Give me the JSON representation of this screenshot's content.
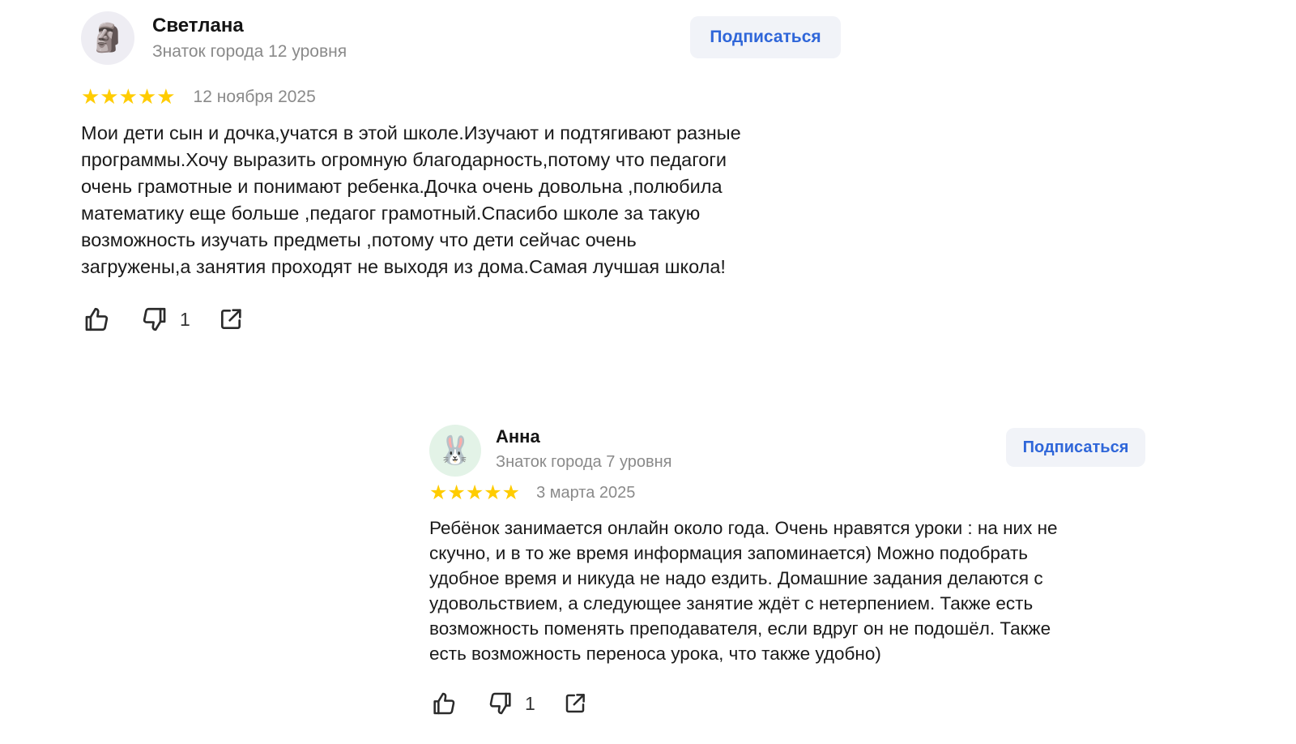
{
  "reviews": [
    {
      "author": "Светлана",
      "level": "Знаток города 12 уровня",
      "avatar_icon": "moai",
      "avatar_glyph": "🗿",
      "subscribe_label": "Подписаться",
      "rating": 5,
      "stars": "★★★★★",
      "date": "12 ноября 2025",
      "text": "Мои дети сын и дочка,учатся в этой школе.Изучают и подтягивают разные\nпрограммы.Хочу выразить огромную благодарность,потому что педагоги\nочень грамотные и понимают ребенка.Дочка очень довольна ,полюбила\nматематику еще больше ,педагог грамотный.Спасибо школе за такую\nвозможность изучать предметы ,потому что дети сейчас очень\nзагружены,а занятия проходят не выходя из дома.Самая лучшая школа!",
      "dislikes": "1"
    },
    {
      "author": "Анна",
      "level": "Знаток города 7 уровня",
      "avatar_icon": "rabbit",
      "avatar_glyph": "🐰",
      "subscribe_label": "Подписаться",
      "rating": 5,
      "stars": "★★★★★",
      "date": "3 марта 2025",
      "text": "Ребёнок занимается онлайн около года. Очень нравятся уроки : на них не\nскучно, и в то же время информация запоминается) Можно подобрать\nудобное время и никуда не надо ездить. Домашние задания делаются с\nудовольствием, а следующее занятие ждёт с нетерпением. Также есть\nвозможность поменять преподавателя, если вдруг он не подошёл. Также\nесть возможность переноса урока, что также удобно)",
      "dislikes": "1"
    }
  ],
  "colors": {
    "star": "#ffcc00",
    "subscribe_text": "#2f66d9",
    "subscribe_bg": "#f1f3f8",
    "meta_text": "#8a8a8a"
  },
  "icons": {
    "like": "thumbs-up-icon",
    "dislike": "thumbs-down-icon",
    "share": "share-icon"
  }
}
